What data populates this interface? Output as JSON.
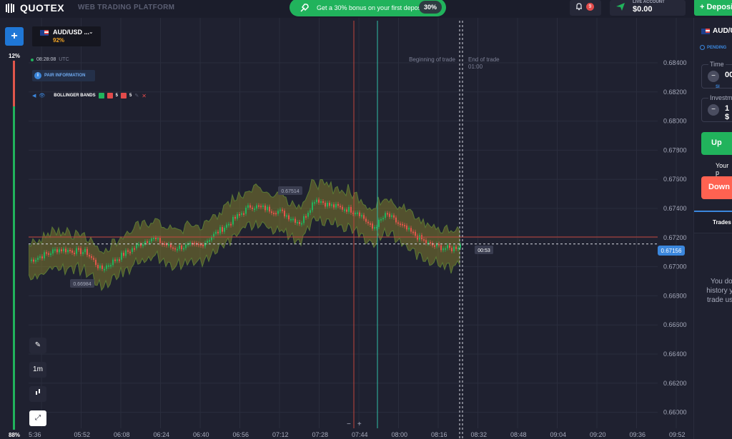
{
  "app": {
    "logo": "QUOTEX",
    "platform": "WEB TRADING PLATFORM"
  },
  "promo": {
    "text": "Get a 30% bonus on your first deposit",
    "badge": "30%"
  },
  "notifications": {
    "count": "9"
  },
  "account": {
    "label": "LIVE ACCOUNT",
    "balance": "$0.00"
  },
  "deposit_label": "Deposit",
  "asset": {
    "name": "AUD/USD",
    "suffix": "...",
    "payout": "92%"
  },
  "clock": {
    "time": "08:28:08",
    "zone": "UTC"
  },
  "pair_info": "PAIR INFORMATION",
  "indicator": {
    "name": "BOLLINGER BANDS",
    "period_1": "5",
    "period_2": "5",
    "colors": [
      "#21b35c",
      "#e24b4b",
      "#e24b4b"
    ]
  },
  "sentiment": {
    "top_pct": "12%",
    "bottom_pct": "88%"
  },
  "tools": {
    "timeframe": "1m"
  },
  "chart_data": {
    "type": "line",
    "series": [],
    "y_ticks": [
      "0.68400",
      "0.68200",
      "0.68000",
      "0.67800",
      "0.67600",
      "0.67400",
      "0.67200",
      "0.67000",
      "0.66800",
      "0.66600",
      "0.66400",
      "0.66200",
      "0.66000"
    ],
    "x_ticks": [
      "5:36",
      "05:52",
      "06:08",
      "06:24",
      "06:40",
      "06:56",
      "07:12",
      "07:28",
      "07:44",
      "08:00",
      "08:16",
      "08:32",
      "08:48",
      "09:04",
      "09:20",
      "09:36",
      "09:52"
    ],
    "ylim": [
      0.659,
      0.6855
    ],
    "current_price": "0.67156",
    "countdown": "00:53",
    "high_label": "0.67514",
    "low_label": "0.66984",
    "beginning_label": "Beginning of trade",
    "end_label": "End of trade",
    "end_time": "01:00",
    "colors": {
      "up": "#21b35c",
      "down": "#e0564b",
      "band": "#7d7a2e"
    }
  },
  "trade_panel": {
    "asset": "AUD/U",
    "pending": "PENDING",
    "time_label": "Time",
    "time_value": "00",
    "time_sub": "SI",
    "investment_label": "Investm",
    "investment_value": "1 $",
    "up_label": "Up",
    "payout_text": "Your p",
    "down_label": "Down",
    "tab_label": "Trades",
    "empty_lines": [
      "You dor",
      "history yet",
      "trade usin"
    ]
  }
}
